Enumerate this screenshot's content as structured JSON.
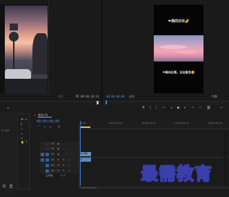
{
  "source_monitor": {
    "timecode_right": "00:00:16:14",
    "fit_label": "1/2"
  },
  "program_monitor": {
    "caption_top": "❤滴向日出🌈",
    "caption_bottom": "❤滴向日落，日出复活🌞",
    "timecode": "00;00;00;00",
    "fit_label": "适合",
    "quality_label": "完整"
  },
  "project_panel": {
    "info_text": "选择...",
    "items_label": "项 选择"
  },
  "timeline": {
    "sequence_tab": "序列 01",
    "timecode": "00;00;00;00",
    "ruler": [
      "00;00",
      "00;00;14;23",
      "00;00;29;23",
      "00;00;44;22",
      "00;00;59;22"
    ],
    "video_tracks": [
      "V3",
      "V2",
      "V1"
    ],
    "audio_tracks": [
      "A1",
      "A2",
      "A3"
    ],
    "master_label": "主声道",
    "master_value": "0.0",
    "clip_v1": "fx 视频",
    "clip_a1": "fx"
  },
  "watermark": "最需教育",
  "colors": {
    "accent": "#4a8fe8",
    "playhead": "#3d7ae0",
    "work_area": "#e8c83c"
  }
}
